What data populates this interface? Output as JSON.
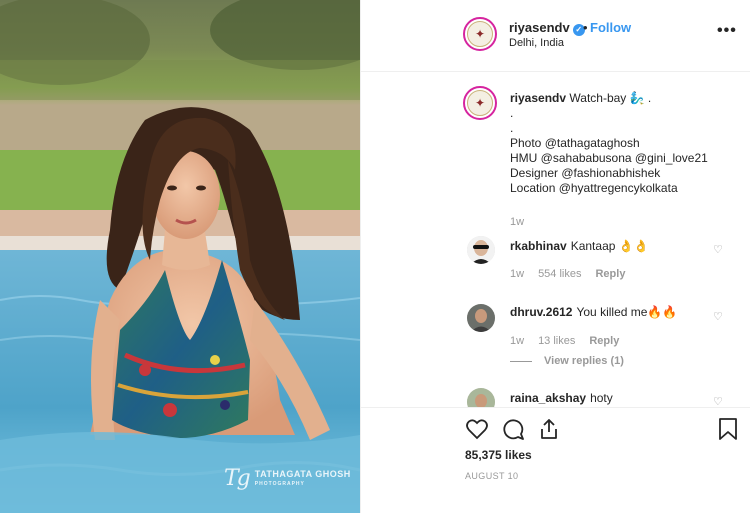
{
  "post": {
    "username": "riyasendv",
    "location": "Delhi, India",
    "follow_label": "Follow",
    "dot": "•",
    "more_label": "•••"
  },
  "photo": {
    "watermark_mark": "Tg",
    "watermark_name": "TATHAGATA GHOSH",
    "watermark_sub": "PHOTOGRAPHY"
  },
  "caption": {
    "username": "riyasendv",
    "text": "Watch-bay 🧞‍♂️ .",
    "lines": [
      ".",
      ".",
      "Photo @tathagataghosh",
      "HMU @sahababusona @gini_love21",
      "Designer @fashionabhishek",
      "Location @hyattregencykolkata"
    ],
    "time": "1w"
  },
  "comments": [
    {
      "username": "rkabhinav",
      "text": "Kantaap 👌👌",
      "time": "1w",
      "likes": "554 likes",
      "reply": "Reply"
    },
    {
      "username": "dhruv.2612",
      "text": "You killed me🔥🔥",
      "time": "1w",
      "likes": "13 likes",
      "reply": "Reply",
      "view_replies": "View replies (1)"
    },
    {
      "username": "raina_akshay",
      "text": "hoty"
    }
  ],
  "footer": {
    "likes": "85,375 likes",
    "date": "AUGUST 10"
  },
  "icons": [
    "heart-icon",
    "comment-icon",
    "share-icon",
    "bookmark-icon",
    "verified-badge-icon",
    "more-options-icon"
  ],
  "colors": {
    "link": "#3897f0",
    "mention": "#003569",
    "muted": "#999999",
    "text": "#262626",
    "story_ring": "#d6249f"
  }
}
